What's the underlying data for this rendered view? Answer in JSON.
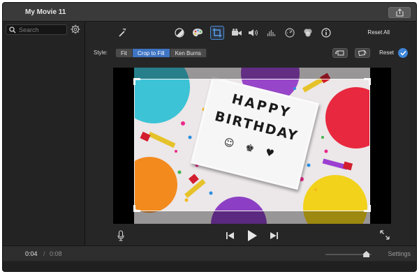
{
  "window": {
    "title": "My Movie 11"
  },
  "sidebar": {
    "search_placeholder": "Search"
  },
  "toolbar": {
    "icons": [
      "magic-wand-icon",
      "color-balance-icon",
      "color-palette-icon",
      "crop-icon",
      "camera-icon",
      "volume-icon",
      "equalizer-icon",
      "speed-icon",
      "filter-icon",
      "info-icon"
    ],
    "active_icon": "crop-icon",
    "reset_all_label": "Reset All"
  },
  "crop_controls": {
    "style_label": "Style:",
    "options": [
      "Fit",
      "Crop to Fill",
      "Ken Burns"
    ],
    "selected": "Crop to Fill",
    "reset_label": "Reset",
    "accent": "#3e74c4"
  },
  "viewer": {
    "image_text": [
      "HAPPY",
      "BIRTHDAY",
      "☺ ♚ ♥"
    ]
  },
  "playback": {
    "current_time": "0:04",
    "separator": "/",
    "total_time": "0:08",
    "settings_label": "Settings",
    "zoom_level": 0.95
  }
}
